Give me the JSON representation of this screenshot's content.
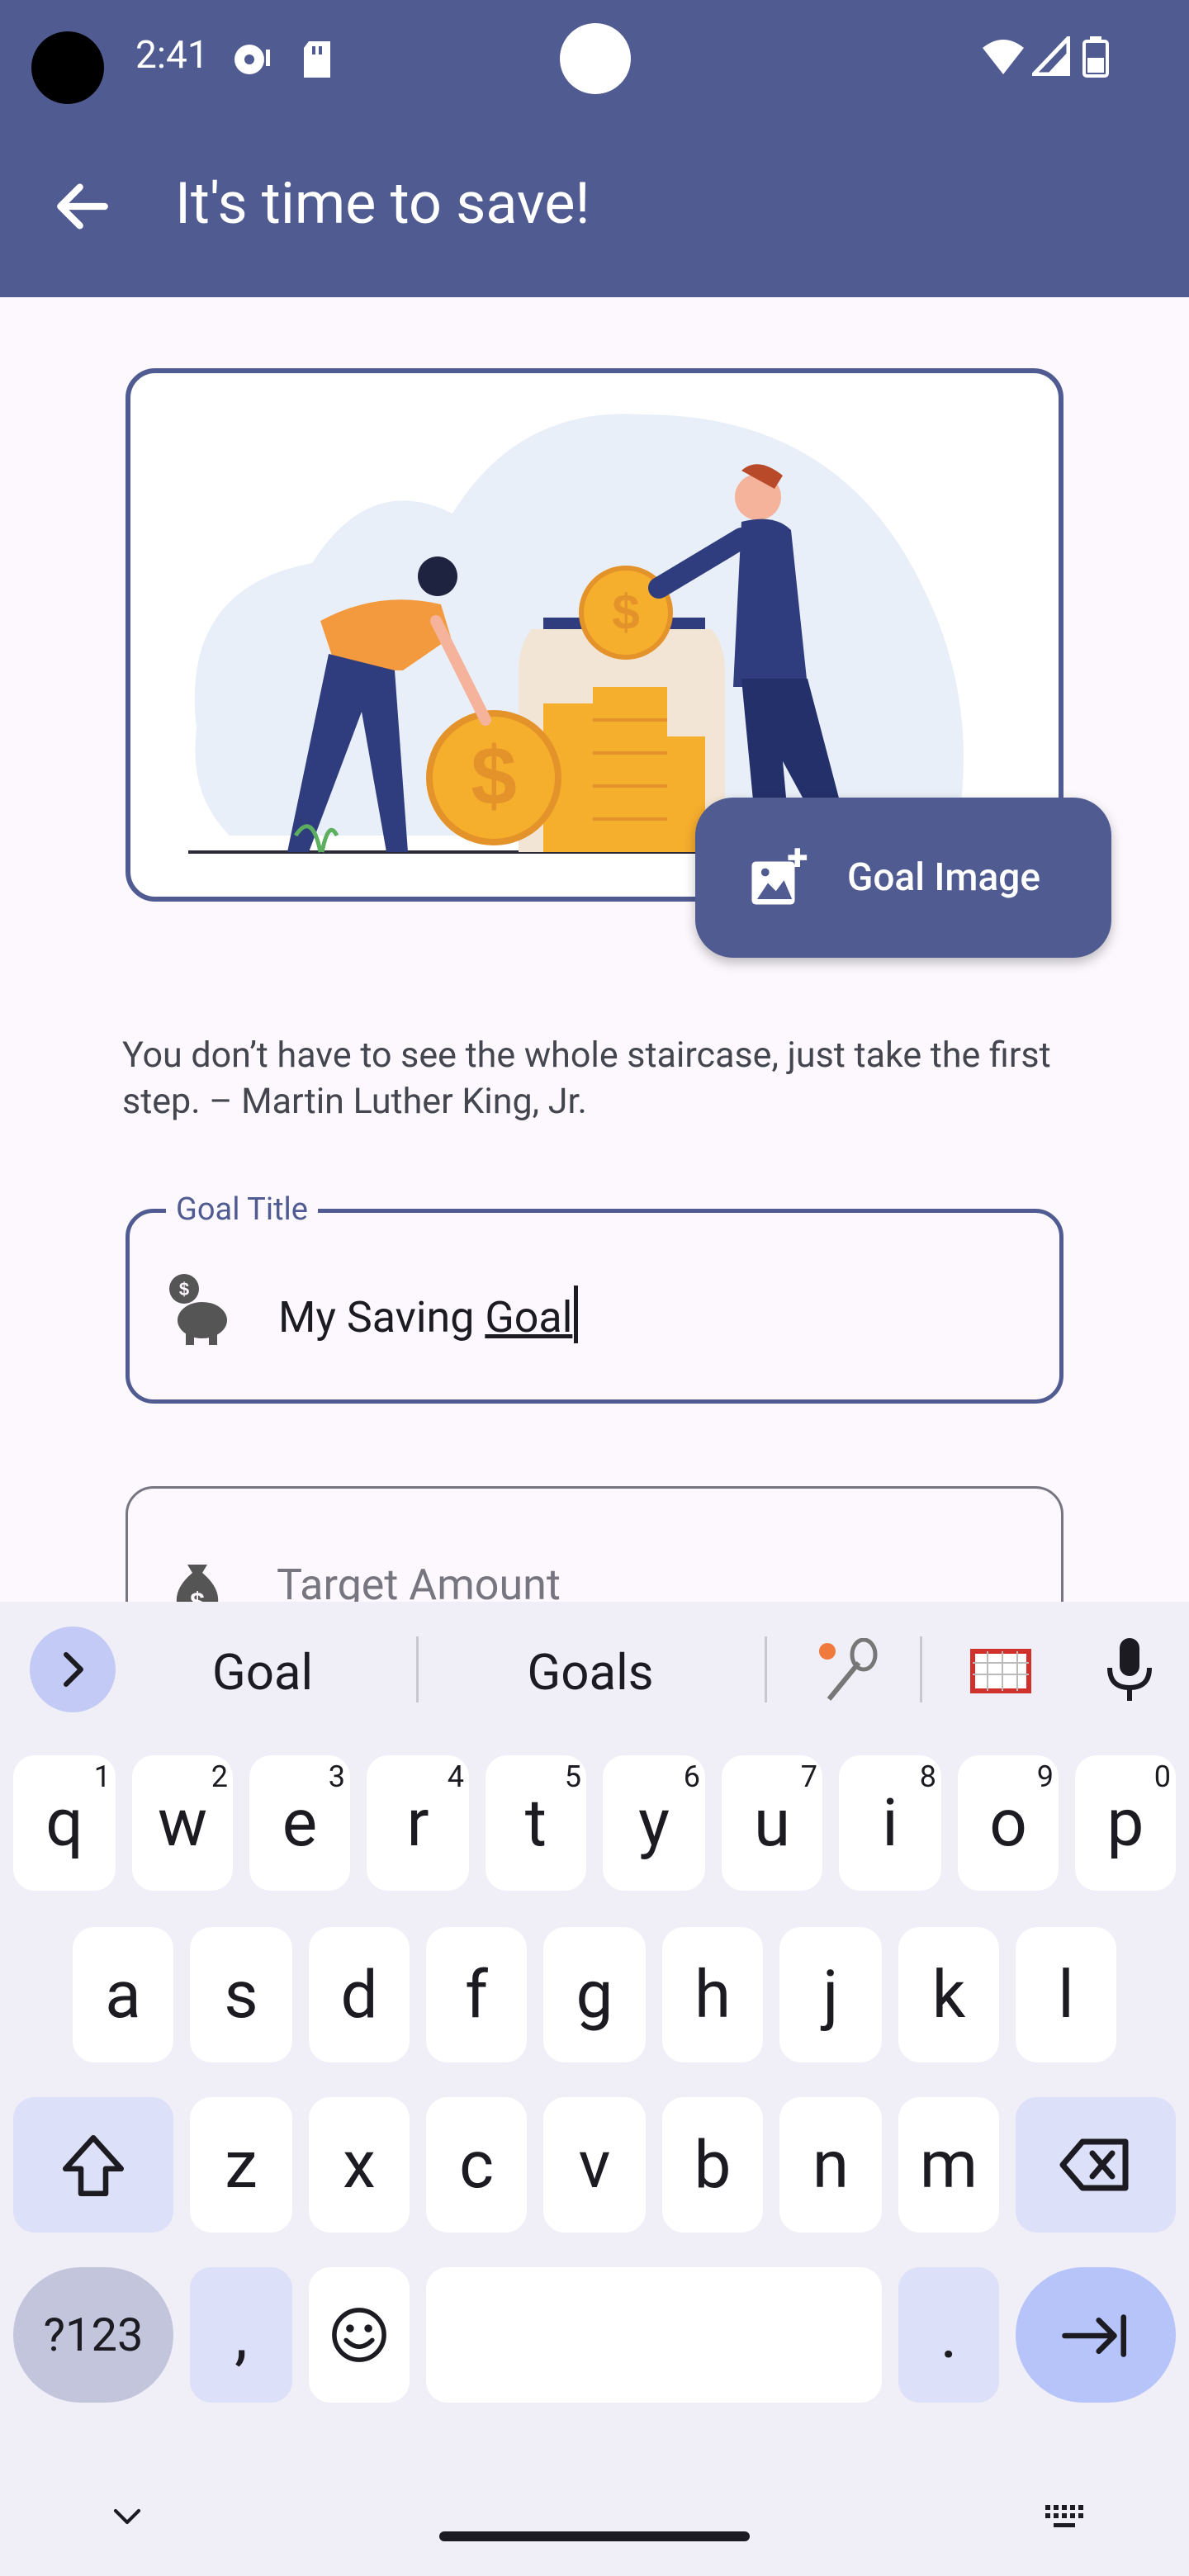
{
  "status": {
    "time": "2:41"
  },
  "appbar": {
    "title": "It's time to save!"
  },
  "goal_image_button": {
    "label": "Goal Image"
  },
  "quote": "You don’t have to see the whole staircase, just take the first step. – Martin Luther King, Jr.",
  "goal_title": {
    "label": "Goal Title",
    "value_prefix": "My Saving ",
    "value_underlined": "Goal"
  },
  "target_amount": {
    "placeholder": "Target Amount"
  },
  "keyboard": {
    "suggestions": [
      "Goal",
      "Goals"
    ],
    "row1": [
      [
        "q",
        "1"
      ],
      [
        "w",
        "2"
      ],
      [
        "e",
        "3"
      ],
      [
        "r",
        "4"
      ],
      [
        "t",
        "5"
      ],
      [
        "y",
        "6"
      ],
      [
        "u",
        "7"
      ],
      [
        "i",
        "8"
      ],
      [
        "o",
        "9"
      ],
      [
        "p",
        "0"
      ]
    ],
    "row2": [
      "a",
      "s",
      "d",
      "f",
      "g",
      "h",
      "j",
      "k",
      "l"
    ],
    "row3": [
      "z",
      "x",
      "c",
      "v",
      "b",
      "n",
      "m"
    ],
    "symbols": "?123",
    "comma": ",",
    "period": "."
  },
  "colors": {
    "primary": "#505B92",
    "surface": "#FCF8FD",
    "keyboard_bg": "#F0EEF6"
  }
}
